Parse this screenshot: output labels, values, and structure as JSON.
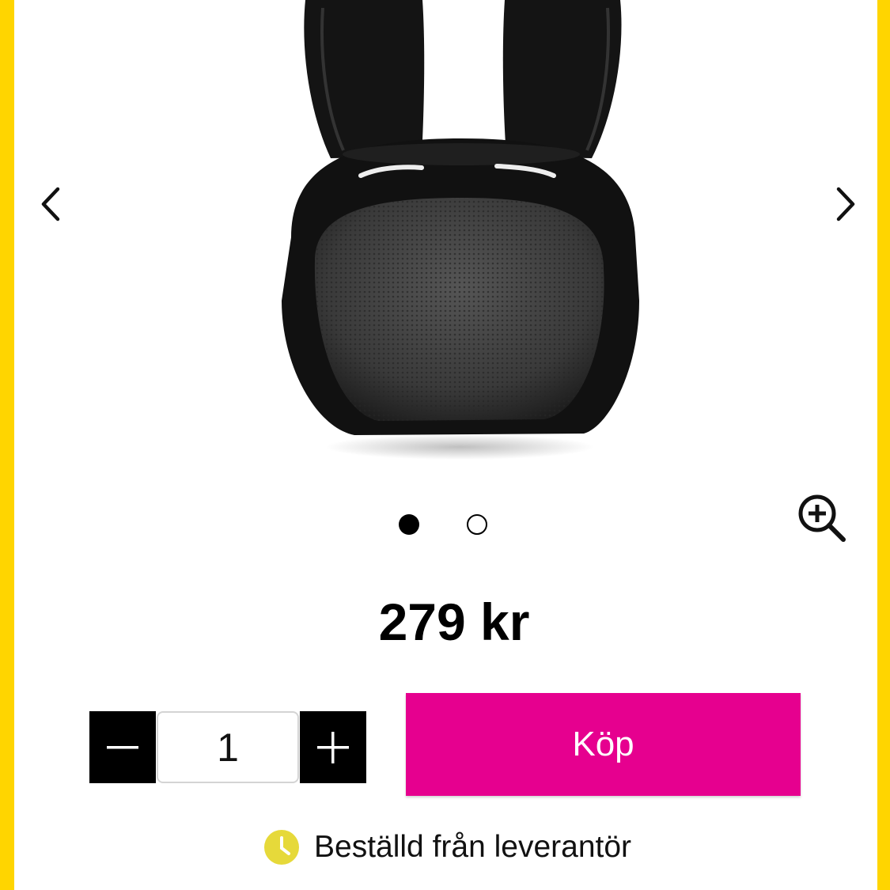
{
  "product": {
    "image_icon": "bunny-speaker-image",
    "price": "279 kr"
  },
  "gallery": {
    "prev_icon": "chevron-left-icon",
    "next_icon": "chevron-right-icon",
    "zoom_icon": "zoom-in-icon",
    "slide_count": 2,
    "active_slide": 1
  },
  "purchase": {
    "quantity": "1",
    "buy_label": "Köp"
  },
  "availability": {
    "status_icon": "clock-icon",
    "status_text": "Beställd från leverantör"
  },
  "colors": {
    "frame": "#FFD500",
    "buy_button": "#E6008F",
    "qty_buttons": "#000000",
    "status_icon": "#E6D93A"
  }
}
